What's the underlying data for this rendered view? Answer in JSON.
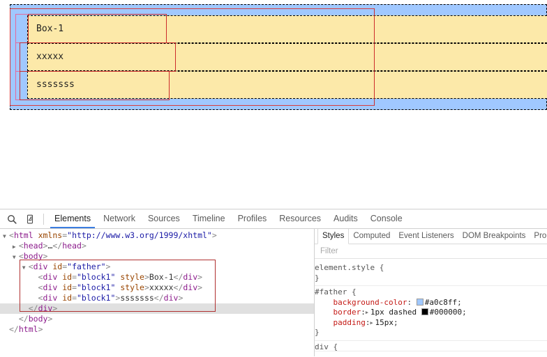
{
  "page": {
    "father_id": "father",
    "blocks": [
      {
        "id": "block1",
        "text": "Box-1"
      },
      {
        "id": "block1",
        "text": "xxxxx"
      },
      {
        "id": "block1",
        "text": "sssssss"
      }
    ]
  },
  "devtools": {
    "toolbar": {
      "inspect_icon": "search-icon",
      "device_icon": "device-toolbar-icon",
      "tabs": [
        {
          "label": "Elements",
          "active": true
        },
        {
          "label": "Network",
          "active": false
        },
        {
          "label": "Sources",
          "active": false
        },
        {
          "label": "Timeline",
          "active": false
        },
        {
          "label": "Profiles",
          "active": false
        },
        {
          "label": "Resources",
          "active": false
        },
        {
          "label": "Audits",
          "active": false
        },
        {
          "label": "Console",
          "active": false
        }
      ]
    },
    "dom": {
      "lines": [
        {
          "indent": 0,
          "triangle": "down",
          "parts": [
            {
              "t": "pn",
              "v": "<"
            },
            {
              "t": "tw",
              "v": "html"
            },
            {
              "t": "pn",
              "v": " "
            },
            {
              "t": "at",
              "v": "xmlns"
            },
            {
              "t": "pn",
              "v": "="
            },
            {
              "t": "av",
              "v": "\"http://www.w3.org/1999/xhtml\""
            },
            {
              "t": "pn",
              "v": ">"
            }
          ]
        },
        {
          "indent": 1,
          "triangle": "right",
          "parts": [
            {
              "t": "pn",
              "v": "<"
            },
            {
              "t": "tw",
              "v": "head"
            },
            {
              "t": "pn",
              "v": ">"
            },
            {
              "t": "tx",
              "v": "…"
            },
            {
              "t": "pn",
              "v": "</"
            },
            {
              "t": "tw",
              "v": "head"
            },
            {
              "t": "pn",
              "v": ">"
            }
          ]
        },
        {
          "indent": 1,
          "triangle": "down",
          "parts": [
            {
              "t": "pn",
              "v": "<"
            },
            {
              "t": "tw",
              "v": "body"
            },
            {
              "t": "pn",
              "v": ">"
            }
          ]
        },
        {
          "indent": 2,
          "triangle": "down",
          "parts": [
            {
              "t": "pn",
              "v": "<"
            },
            {
              "t": "tw",
              "v": "div"
            },
            {
              "t": "pn",
              "v": " "
            },
            {
              "t": "at",
              "v": "id"
            },
            {
              "t": "pn",
              "v": "="
            },
            {
              "t": "av",
              "v": "\"father\""
            },
            {
              "t": "pn",
              "v": ">"
            }
          ]
        },
        {
          "indent": 3,
          "triangle": "none",
          "parts": [
            {
              "t": "pn",
              "v": "<"
            },
            {
              "t": "tw",
              "v": "div"
            },
            {
              "t": "pn",
              "v": " "
            },
            {
              "t": "at",
              "v": "id"
            },
            {
              "t": "pn",
              "v": "="
            },
            {
              "t": "av",
              "v": "\"block1\""
            },
            {
              "t": "pn",
              "v": " "
            },
            {
              "t": "at",
              "v": "style"
            },
            {
              "t": "pn",
              "v": ">"
            },
            {
              "t": "tx",
              "v": "Box-1"
            },
            {
              "t": "pn",
              "v": "</"
            },
            {
              "t": "tw",
              "v": "div"
            },
            {
              "t": "pn",
              "v": ">"
            }
          ]
        },
        {
          "indent": 3,
          "triangle": "none",
          "parts": [
            {
              "t": "pn",
              "v": "<"
            },
            {
              "t": "tw",
              "v": "div"
            },
            {
              "t": "pn",
              "v": " "
            },
            {
              "t": "at",
              "v": "id"
            },
            {
              "t": "pn",
              "v": "="
            },
            {
              "t": "av",
              "v": "\"block1\""
            },
            {
              "t": "pn",
              "v": " "
            },
            {
              "t": "at",
              "v": "style"
            },
            {
              "t": "pn",
              "v": ">"
            },
            {
              "t": "tx",
              "v": "xxxxx"
            },
            {
              "t": "pn",
              "v": "</"
            },
            {
              "t": "tw",
              "v": "div"
            },
            {
              "t": "pn",
              "v": ">"
            }
          ]
        },
        {
          "indent": 3,
          "triangle": "none",
          "parts": [
            {
              "t": "pn",
              "v": "<"
            },
            {
              "t": "tw",
              "v": "div"
            },
            {
              "t": "pn",
              "v": " "
            },
            {
              "t": "at",
              "v": "id"
            },
            {
              "t": "pn",
              "v": "="
            },
            {
              "t": "av",
              "v": "\"block1\""
            },
            {
              "t": "pn",
              "v": ">"
            },
            {
              "t": "tx",
              "v": "sssssss"
            },
            {
              "t": "pn",
              "v": "</"
            },
            {
              "t": "tw",
              "v": "div"
            },
            {
              "t": "pn",
              "v": ">"
            }
          ]
        },
        {
          "indent": 2,
          "triangle": "none",
          "selected": true,
          "parts": [
            {
              "t": "pn",
              "v": "</"
            },
            {
              "t": "tw",
              "v": "div"
            },
            {
              "t": "pn",
              "v": ">"
            }
          ]
        },
        {
          "indent": 1,
          "triangle": "none",
          "parts": [
            {
              "t": "pn",
              "v": "</"
            },
            {
              "t": "tw",
              "v": "body"
            },
            {
              "t": "pn",
              "v": ">"
            }
          ]
        },
        {
          "indent": 0,
          "triangle": "none",
          "parts": [
            {
              "t": "pn",
              "v": "</"
            },
            {
              "t": "tw",
              "v": "html"
            },
            {
              "t": "pn",
              "v": ">"
            }
          ]
        }
      ]
    },
    "sidebar": {
      "tabs": [
        {
          "label": "Styles",
          "active": true
        },
        {
          "label": "Computed",
          "active": false
        },
        {
          "label": "Event Listeners",
          "active": false
        },
        {
          "label": "DOM Breakpoints",
          "active": false
        },
        {
          "label": "Prop",
          "active": false
        }
      ],
      "filter_placeholder": "Filter",
      "rules": [
        {
          "selector": "element.style",
          "declarations": []
        },
        {
          "selector": "#father",
          "declarations": [
            {
              "property": "background-color",
              "value": "#a0c8ff",
              "swatch": "#a0c8ff",
              "expander": false
            },
            {
              "property": "border",
              "value": "1px dashed",
              "extra_value": "#000000",
              "swatch": "#000000",
              "expander": true
            },
            {
              "property": "padding",
              "value": "15px",
              "expander": true
            }
          ]
        },
        {
          "selector": "div",
          "declarations": []
        }
      ]
    }
  }
}
